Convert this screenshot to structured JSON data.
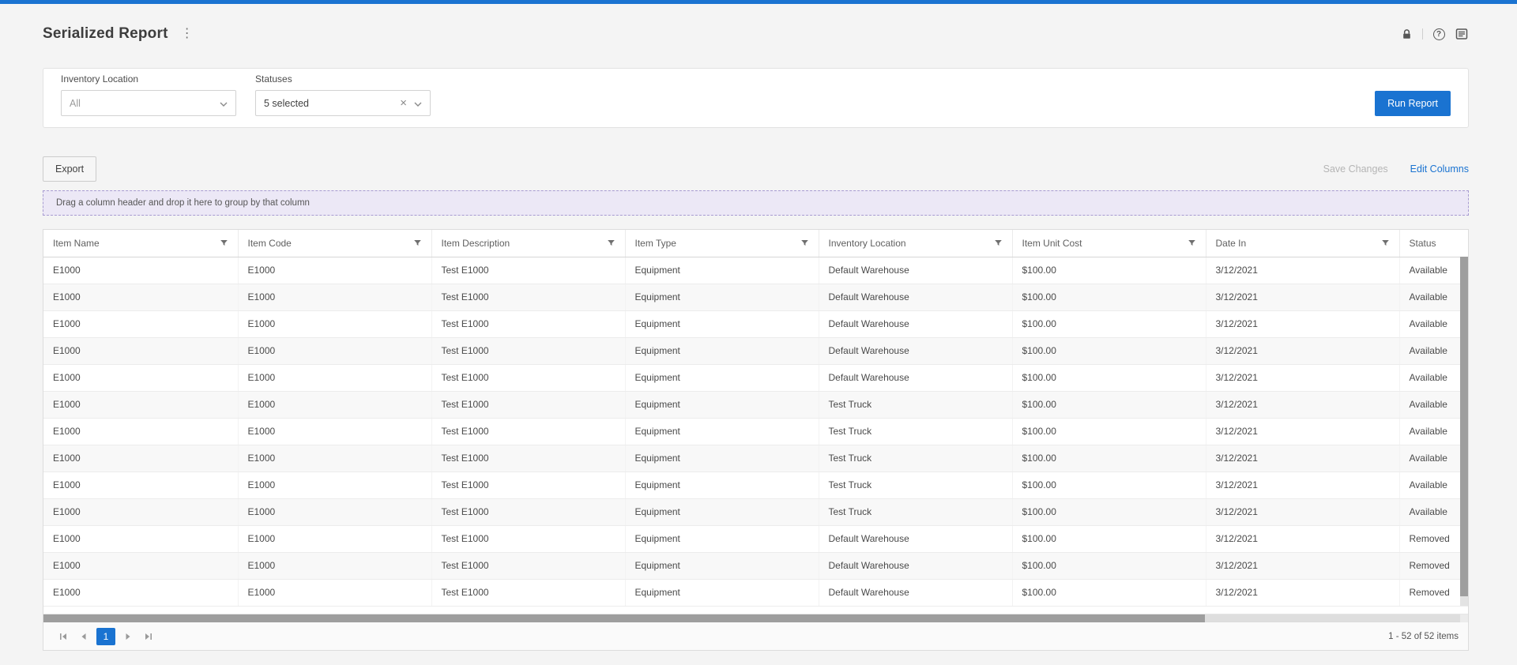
{
  "colors": {
    "accent": "#1a73d1",
    "topbar": "#1a73d1",
    "group_zone_bg": "#ece8f6",
    "group_zone_border": "#a79bd1",
    "scrollbar_thumb": "#9e9e9e"
  },
  "icons": {
    "kebab": "⋮",
    "clear": "×",
    "help": "?"
  },
  "header": {
    "title": "Serialized Report"
  },
  "filters": {
    "inventory_location_label": "Inventory Location",
    "inventory_location_value": "All",
    "statuses_label": "Statuses",
    "statuses_value": "5 selected",
    "run_report_label": "Run Report"
  },
  "toolbar": {
    "export_label": "Export",
    "save_changes_label": "Save Changes",
    "edit_columns_label": "Edit Columns"
  },
  "grid": {
    "group_hint": "Drag a column header and drop it here to group by that column",
    "columns": [
      "Item Name",
      "Item Code",
      "Item Description",
      "Item Type",
      "Inventory Location",
      "Item Unit Cost",
      "Date In",
      "Status"
    ],
    "rows": [
      [
        "E1000",
        "E1000",
        "Test E1000",
        "Equipment",
        "Default Warehouse",
        "$100.00",
        "3/12/2021",
        "Available"
      ],
      [
        "E1000",
        "E1000",
        "Test E1000",
        "Equipment",
        "Default Warehouse",
        "$100.00",
        "3/12/2021",
        "Available"
      ],
      [
        "E1000",
        "E1000",
        "Test E1000",
        "Equipment",
        "Default Warehouse",
        "$100.00",
        "3/12/2021",
        "Available"
      ],
      [
        "E1000",
        "E1000",
        "Test E1000",
        "Equipment",
        "Default Warehouse",
        "$100.00",
        "3/12/2021",
        "Available"
      ],
      [
        "E1000",
        "E1000",
        "Test E1000",
        "Equipment",
        "Default Warehouse",
        "$100.00",
        "3/12/2021",
        "Available"
      ],
      [
        "E1000",
        "E1000",
        "Test E1000",
        "Equipment",
        "Test Truck",
        "$100.00",
        "3/12/2021",
        "Available"
      ],
      [
        "E1000",
        "E1000",
        "Test E1000",
        "Equipment",
        "Test Truck",
        "$100.00",
        "3/12/2021",
        "Available"
      ],
      [
        "E1000",
        "E1000",
        "Test E1000",
        "Equipment",
        "Test Truck",
        "$100.00",
        "3/12/2021",
        "Available"
      ],
      [
        "E1000",
        "E1000",
        "Test E1000",
        "Equipment",
        "Test Truck",
        "$100.00",
        "3/12/2021",
        "Available"
      ],
      [
        "E1000",
        "E1000",
        "Test E1000",
        "Equipment",
        "Test Truck",
        "$100.00",
        "3/12/2021",
        "Available"
      ],
      [
        "E1000",
        "E1000",
        "Test E1000",
        "Equipment",
        "Default Warehouse",
        "$100.00",
        "3/12/2021",
        "Removed"
      ],
      [
        "E1000",
        "E1000",
        "Test E1000",
        "Equipment",
        "Default Warehouse",
        "$100.00",
        "3/12/2021",
        "Removed"
      ],
      [
        "E1000",
        "E1000",
        "Test E1000",
        "Equipment",
        "Default Warehouse",
        "$100.00",
        "3/12/2021",
        "Removed"
      ]
    ],
    "pager": {
      "page": "1",
      "summary": "1 - 52 of 52 items"
    }
  }
}
